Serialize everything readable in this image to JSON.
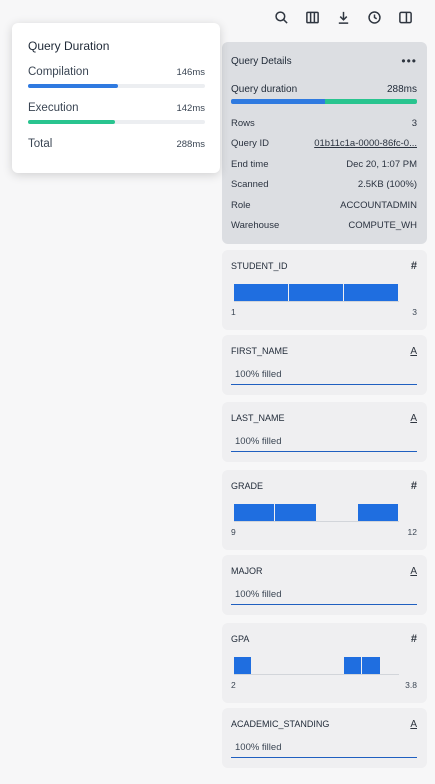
{
  "toolbar": {
    "icons": [
      "search-icon",
      "columns-icon",
      "download-icon",
      "history-icon",
      "split-panel-icon"
    ]
  },
  "popover": {
    "title": "Query Duration",
    "rows": [
      {
        "label": "Compilation",
        "value": "146ms",
        "fraction": 0.507,
        "color": "#2f7ae0"
      },
      {
        "label": "Execution",
        "value": "142ms",
        "fraction": 0.493,
        "color": "#29c48f"
      }
    ],
    "total_label": "Total",
    "total_value": "288ms"
  },
  "details": {
    "title": "Query Details",
    "duration_label": "Query duration",
    "duration_value": "288ms",
    "duration_split": [
      {
        "fraction": 0.507,
        "color": "#2f7ae0"
      },
      {
        "fraction": 0.493,
        "color": "#29c48f"
      }
    ],
    "fields": [
      {
        "key": "Rows",
        "value": "3"
      },
      {
        "key": "Query ID",
        "value": "01b11c1a-0000-86fc-0...",
        "link": true
      },
      {
        "key": "End time",
        "value": "Dec 20, 1:07 PM"
      },
      {
        "key": "Scanned",
        "value": "2.5KB (100%)"
      },
      {
        "key": "Role",
        "value": "ACCOUNTADMIN"
      },
      {
        "key": "Warehouse",
        "value": "COMPUTE_WH"
      }
    ]
  },
  "columns": [
    {
      "name": "STUDENT_ID",
      "type": "numeric",
      "min": "1",
      "max": "3",
      "bins": [
        {
          "start": 0.0,
          "end": 0.333
        },
        {
          "start": 0.333,
          "end": 0.667
        },
        {
          "start": 0.667,
          "end": 1.0
        }
      ]
    },
    {
      "name": "FIRST_NAME",
      "type": "text",
      "filled": "100% filled"
    },
    {
      "name": "LAST_NAME",
      "type": "text",
      "filled": "100% filled"
    },
    {
      "name": "GRADE",
      "type": "numeric",
      "min": "9",
      "max": "12",
      "bins": [
        {
          "start": 0.0,
          "end": 0.25
        },
        {
          "start": 0.25,
          "end": 0.5
        },
        {
          "start": 0.75,
          "end": 1.0
        }
      ]
    },
    {
      "name": "MAJOR",
      "type": "text",
      "filled": "100% filled"
    },
    {
      "name": "GPA",
      "type": "numeric",
      "min": "2",
      "max": "3.8",
      "bins": [
        {
          "start": 0.0,
          "end": 0.111
        },
        {
          "start": 0.667,
          "end": 0.778
        },
        {
          "start": 0.778,
          "end": 0.889
        }
      ]
    },
    {
      "name": "ACADEMIC_STANDING",
      "type": "text",
      "filled": "100% filled"
    }
  ]
}
